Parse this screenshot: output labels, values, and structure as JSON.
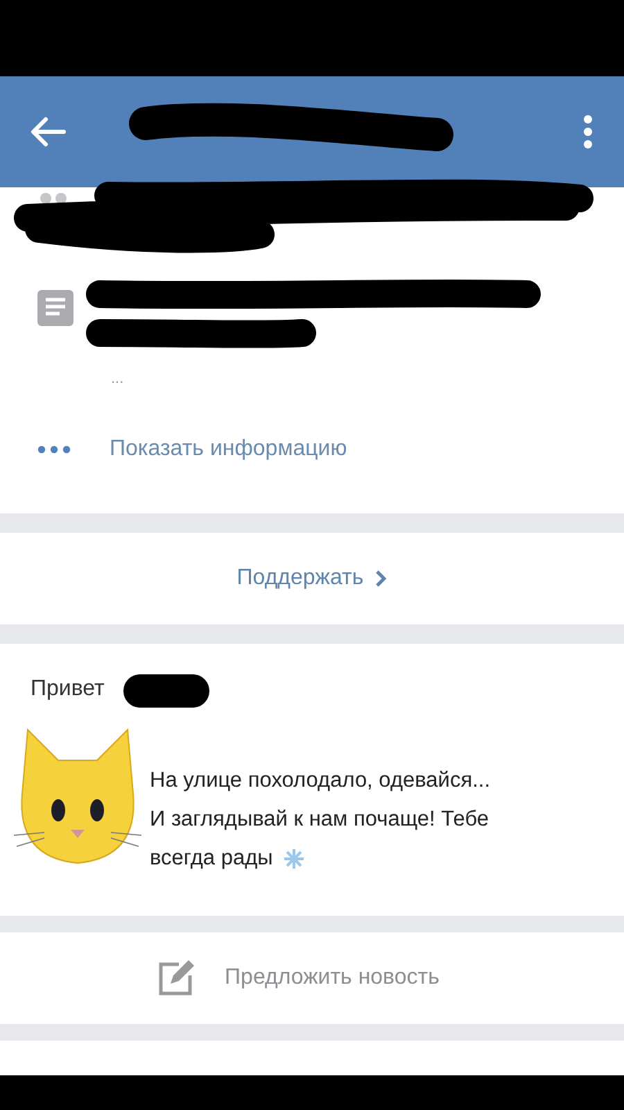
{
  "info": {
    "more_text": "...",
    "show_info": "Показать информацию"
  },
  "support": {
    "label": "Поддержать"
  },
  "post": {
    "greeting": "Привет",
    "lines": [
      "На улице похолодало, одевайся...",
      "И заглядывай к нам почаще! Тебе",
      "всегда рады"
    ]
  },
  "suggest": {
    "label": "Предложить новость"
  }
}
